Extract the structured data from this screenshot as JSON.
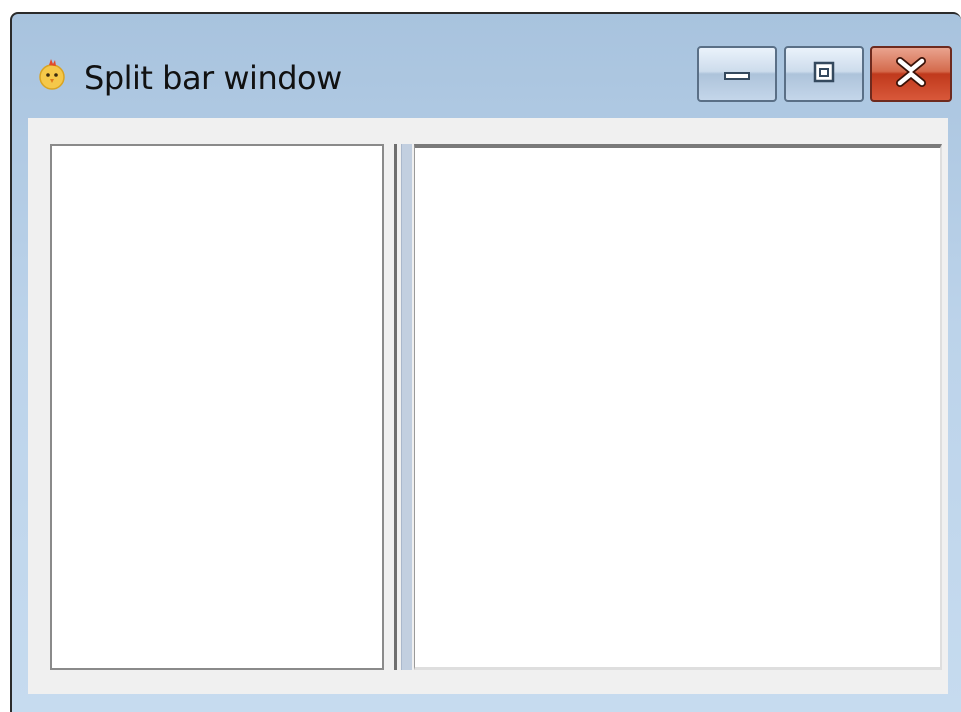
{
  "window": {
    "title": "Split bar window",
    "app_icon": "chicken-icon",
    "caption_buttons": {
      "minimize_icon": "minimize-icon",
      "maximize_icon": "maximize-icon",
      "close_icon": "close-icon"
    }
  },
  "colors": {
    "titlebar": "#b7cfe8",
    "client_background": "#f0f0f0",
    "pane_background": "#ffffff",
    "close_button": "#c74a2c",
    "splitter_thumb": "#c2cfe0"
  }
}
